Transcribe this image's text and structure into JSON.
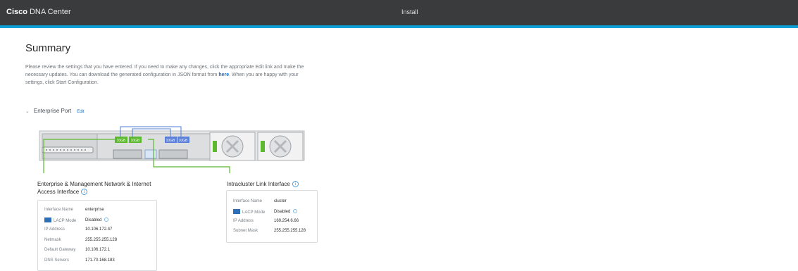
{
  "header": {
    "brand_bold": "Cisco",
    "brand_rest": "DNA Center",
    "title": "Install"
  },
  "colors": {
    "header_bg": "#3a3b3d",
    "accent": "#0d9fd8",
    "link": "#0a6ed1",
    "enterprise_line": "#5cb82e",
    "cluster_line": "#4f7bd6"
  },
  "summary": {
    "title": "Summary",
    "intro_before_link": "Please review the settings that you have entered. If you need to make any changes, click the appropriate Edit link and make the necessary updates. You can download the generated configuration in JSON format from ",
    "intro_link": "here",
    "intro_after_link": ". When you are happy with your settings, click Start Configuration."
  },
  "section": {
    "title": "Enterprise Port",
    "edit_label": "Edit",
    "chevron_icon": "chevron-down-icon"
  },
  "diagram": {
    "port_labels": [
      "10GB",
      "10GB",
      "10GB",
      "10GB"
    ]
  },
  "enterprise_interface": {
    "title_line1": "Enterprise & Management Network & Internet",
    "title_line2": "Access Interface",
    "rows": [
      {
        "label": "Interface Name",
        "value": "enterprise"
      },
      {
        "label": "LACP Mode",
        "value": "Disabled"
      },
      {
        "label": "IP Address",
        "value": "10.106.172.47"
      },
      {
        "label": "Netmask",
        "value": "255.255.255.128"
      },
      {
        "label": "Default Gateway",
        "value": "10.106.172.1"
      },
      {
        "label": "DNS Servers",
        "value": "171.70.168.183"
      }
    ]
  },
  "cluster_interface": {
    "title": "Intracluster Link Interface",
    "rows": [
      {
        "label": "Interface Name",
        "value": "cluster"
      },
      {
        "label": "LACP Mode",
        "value": "Disabled"
      },
      {
        "label": "IP Address",
        "value": "169.254.6.66"
      },
      {
        "label": "Subnet Mask",
        "value": "255.255.255.128"
      }
    ]
  }
}
